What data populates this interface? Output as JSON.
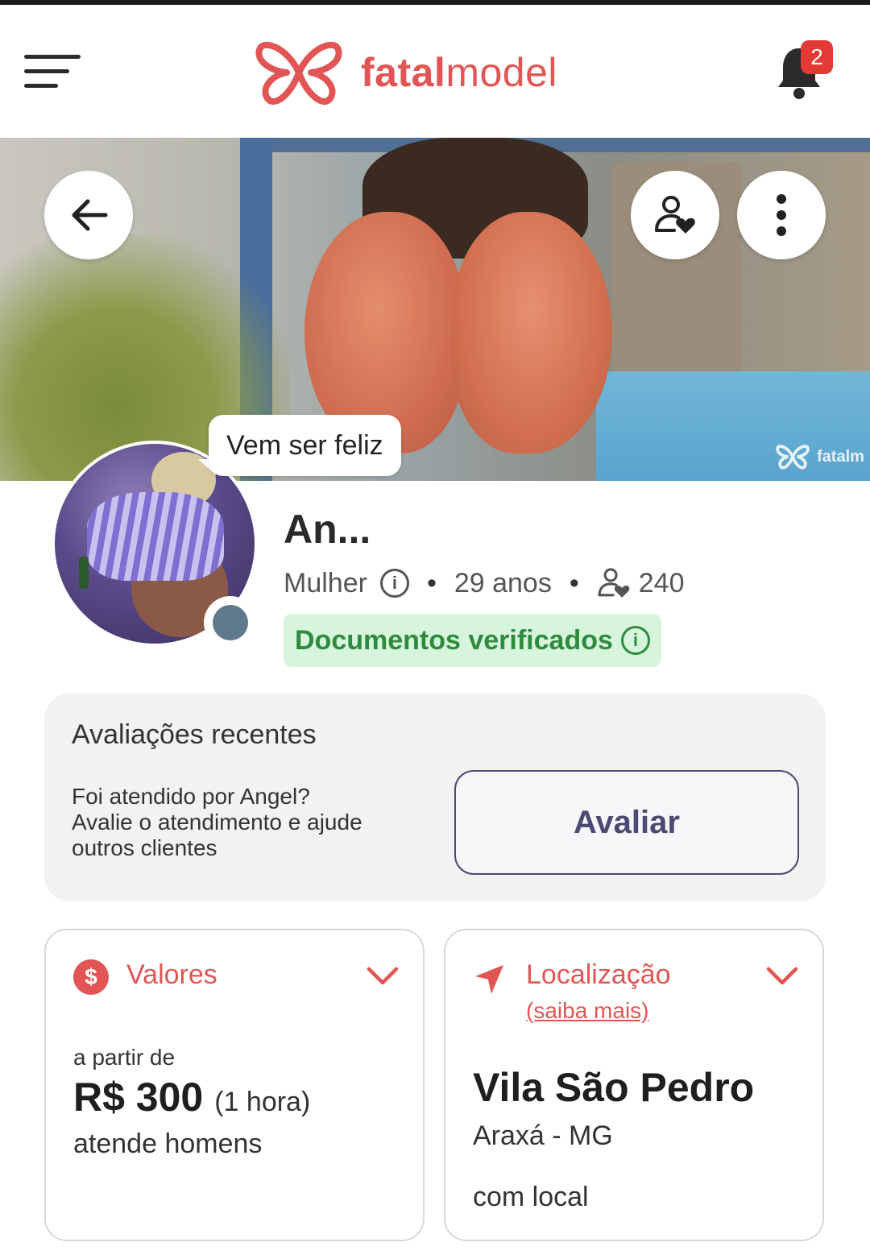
{
  "header": {
    "logo_bold": "fatal",
    "logo_regular": "model",
    "notification_count": "2"
  },
  "hero": {
    "watermark": "fatalm"
  },
  "profile": {
    "status_message": "Vem ser feliz",
    "name": "An...",
    "gender": "Mulher",
    "age": "29 anos",
    "followers": "240",
    "verified_label": "Documentos verificados",
    "online_status_color": "#5f7a8a"
  },
  "reviews": {
    "title": "Avaliações recentes",
    "prompt_line1": "Foi atendido por Angel?",
    "prompt_line2": "Avalie o atendimento e ajude outros clientes",
    "button_label": "Avaliar"
  },
  "prices": {
    "title": "Valores",
    "from_label": "a partir de",
    "amount": "R$ 300",
    "unit": "(1 hora)",
    "audience": "atende homens"
  },
  "location": {
    "title": "Localização",
    "more_link": "(saiba mais)",
    "neighborhood": "Vila São Pedro",
    "city": "Araxá - MG",
    "venue": "com local"
  },
  "colors": {
    "brand": "#e25555",
    "verified_bg": "#d7f5dc",
    "verified_text": "#2e8b3e",
    "button_border": "#4b4a72"
  },
  "icons": [
    "menu-icon",
    "butterfly-logo-icon",
    "bell-icon",
    "back-arrow-icon",
    "follow-heart-icon",
    "more-vertical-icon",
    "info-icon",
    "follower-heart-icon",
    "dollar-icon",
    "chevron-down-icon",
    "navigation-arrow-icon"
  ]
}
